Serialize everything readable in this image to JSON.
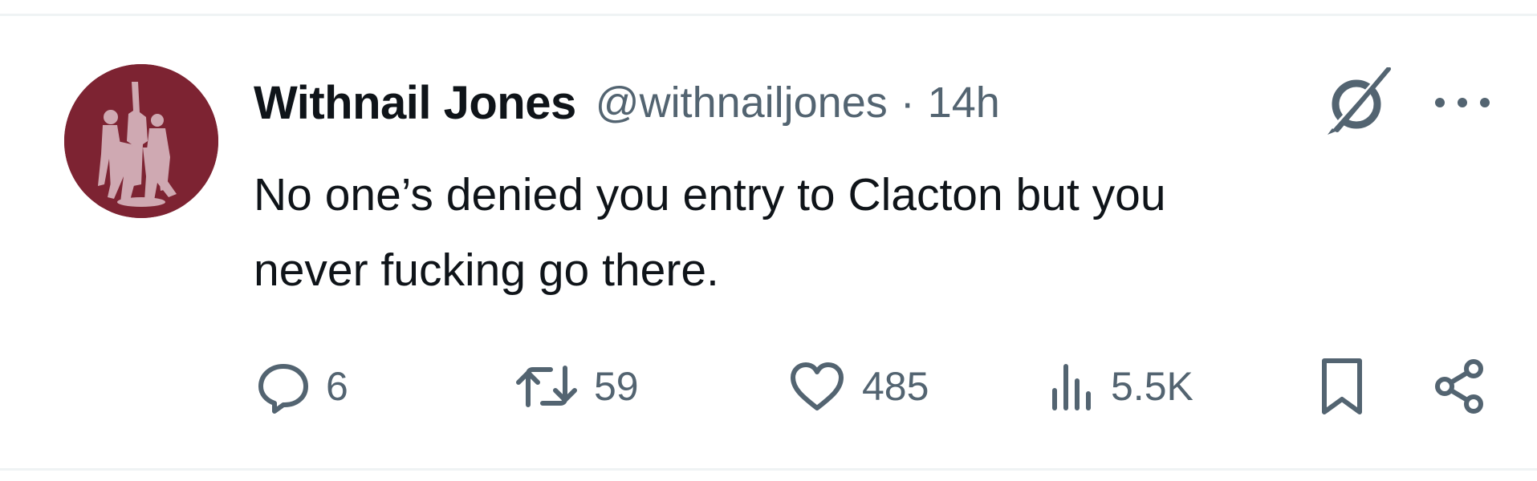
{
  "tweet": {
    "author_name": "Withnail Jones",
    "author_handle": "@withnailjones",
    "separator": "·",
    "timestamp": "14h",
    "text_line1": "No one’s denied you entry to Clacton but you",
    "text_line2": "never fucking go there.",
    "avatar_color": "#7d2332"
  },
  "actions": {
    "replies": "6",
    "reposts": "59",
    "likes": "485",
    "views": "5.5K"
  },
  "icons": {
    "grok": "grok-icon",
    "more": "more-options-icon",
    "reply": "reply-icon",
    "repost": "repost-icon",
    "like": "heart-icon",
    "views": "views-icon",
    "bookmark": "bookmark-icon",
    "share": "share-icon"
  },
  "colors": {
    "text_primary": "#0f1419",
    "text_secondary": "#536471",
    "divider": "#eff3f4"
  }
}
